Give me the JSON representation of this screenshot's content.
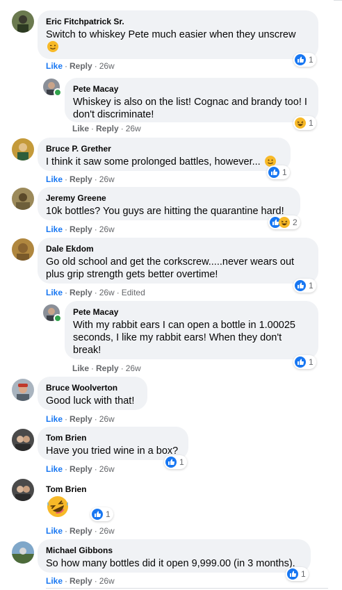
{
  "comments": [
    {
      "author": "Eric Fitchpatrick Sr.",
      "text": "Switch to whiskey Pete much easier when they unscrew",
      "has_emoji": true,
      "like": "Like",
      "reply": "Reply",
      "time": "26w",
      "edited": "",
      "reactions": "1"
    },
    {
      "author": "Pete Macay",
      "text": "Whiskey is also on the list! Cognac and brandy too! I don't discriminate!",
      "like": "Like",
      "reply": "Reply",
      "time": "26w",
      "edited": "",
      "reactions": "1"
    },
    {
      "author": "Bruce P. Grether",
      "text": "I think it saw some prolonged battles, however...",
      "has_emoji": true,
      "like": "Like",
      "reply": "Reply",
      "time": "26w",
      "edited": "",
      "reactions": "1"
    },
    {
      "author": "Jeremy Greene",
      "text": "10k bottles? You guys are hitting the quarantine hard!",
      "like": "Like",
      "reply": "Reply",
      "time": "26w",
      "edited": "",
      "reactions": "2"
    },
    {
      "author": "Dale Ekdom",
      "text": "Go old school and get the corkscrew.....never wears out plus grip strength gets better overtime!",
      "like": "Like",
      "reply": "Reply",
      "time": "26w",
      "edited": "Edited",
      "reactions": "1"
    },
    {
      "author": "Pete Macay",
      "text": "With my rabbit ears I can open a bottle in 1.00025 seconds, I like my rabbit ears! When they don't break!",
      "like": "Like",
      "reply": "Reply",
      "time": "26w",
      "edited": "",
      "reactions": "1"
    },
    {
      "author": "Bruce Woolverton",
      "text": "Good luck with that!",
      "like": "Like",
      "reply": "Reply",
      "time": "26w",
      "edited": ""
    },
    {
      "author": "Tom Brien",
      "text": "Have you tried wine in a box?",
      "like": "Like",
      "reply": "Reply",
      "time": "26w",
      "edited": "",
      "reactions": "1"
    },
    {
      "author": "Tom Brien",
      "text": "",
      "like": "Like",
      "reply": "Reply",
      "time": "26w",
      "edited": "",
      "reactions": "1"
    },
    {
      "author": "Michael Gibbons",
      "text": "So how many bottles did it open 9,999.00 (in 3 months).",
      "like": "Like",
      "reply": "Reply",
      "time": "26w",
      "edited": "",
      "reactions": "1"
    }
  ],
  "colors": {
    "like_blue": "#1877f2",
    "bubble": "#f0f2f5",
    "meta": "#65676b",
    "online": "#31a24c",
    "haha_yellow": "#f7b928",
    "love_red": "#f33e58"
  },
  "icons": {
    "like": "thumbs-up-icon",
    "haha": "laughing-face-icon",
    "wink": "winking-face-icon",
    "smile": "smiling-face-icon",
    "laugh_cry": "rolling-laughing-face-icon"
  }
}
